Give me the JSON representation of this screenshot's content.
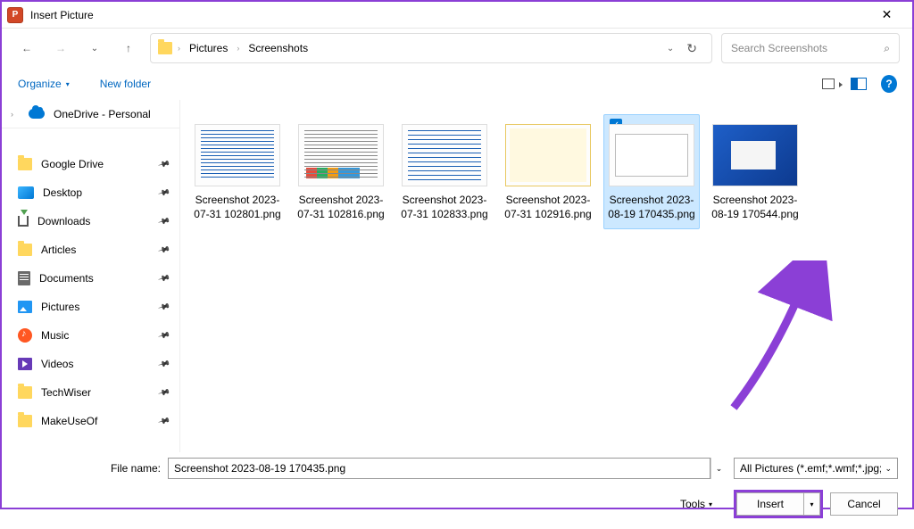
{
  "title": "Insert Picture",
  "breadcrumb": {
    "parts": [
      "Pictures",
      "Screenshots"
    ]
  },
  "search": {
    "placeholder": "Search Screenshots"
  },
  "toolbar": {
    "organize": "Organize",
    "new_folder": "New folder"
  },
  "sidebar": {
    "onedrive": "OneDrive - Personal",
    "items": [
      {
        "label": "Google Drive",
        "icon": "folder"
      },
      {
        "label": "Desktop",
        "icon": "desktop"
      },
      {
        "label": "Downloads",
        "icon": "downloads"
      },
      {
        "label": "Articles",
        "icon": "folder"
      },
      {
        "label": "Documents",
        "icon": "docs"
      },
      {
        "label": "Pictures",
        "icon": "pics"
      },
      {
        "label": "Music",
        "icon": "music"
      },
      {
        "label": "Videos",
        "icon": "video"
      },
      {
        "label": "TechWiser",
        "icon": "folder"
      },
      {
        "label": "MakeUseOf",
        "icon": "folder"
      }
    ]
  },
  "files": [
    {
      "name": "Screenshot 2023-07-31 102801.png",
      "thumb": "t1",
      "selected": false
    },
    {
      "name": "Screenshot 2023-07-31 102816.png",
      "thumb": "t2",
      "selected": false
    },
    {
      "name": "Screenshot 2023-07-31 102833.png",
      "thumb": "t3",
      "selected": false
    },
    {
      "name": "Screenshot 2023-07-31 102916.png",
      "thumb": "t4",
      "selected": false
    },
    {
      "name": "Screenshot 2023-08-19 170435.png",
      "thumb": "t5",
      "selected": true
    },
    {
      "name": "Screenshot 2023-08-19 170544.png",
      "thumb": "t6",
      "selected": false
    }
  ],
  "bottom": {
    "filename_label": "File name:",
    "filename_value": "Screenshot 2023-08-19 170435.png",
    "filter": "All Pictures (*.emf;*.wmf;*.jpg;*.j",
    "tools": "Tools",
    "insert": "Insert",
    "cancel": "Cancel"
  }
}
